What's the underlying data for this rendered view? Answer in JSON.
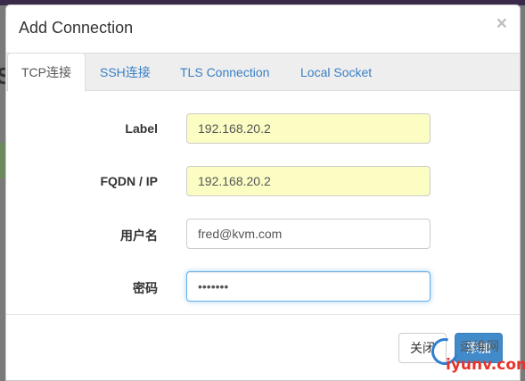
{
  "dialog": {
    "title": "Add Connection",
    "close_glyph": "×"
  },
  "tabs": [
    {
      "label": "TCP连接",
      "active": true
    },
    {
      "label": "SSH连接",
      "active": false
    },
    {
      "label": "TLS Connection",
      "active": false
    },
    {
      "label": "Local Socket",
      "active": false
    }
  ],
  "form": {
    "label": {
      "label": "Label",
      "value": "192.168.20.2"
    },
    "fqdn": {
      "label": "FQDN / IP",
      "value": "192.168.20.2"
    },
    "username": {
      "label": "用户名",
      "value": "fred@kvm.com"
    },
    "password": {
      "label": "密码",
      "value": "•••••••"
    }
  },
  "footer": {
    "close_label": "关闭",
    "add_label": "添加"
  },
  "watermark": {
    "text_top": "运维网",
    "text": "iyunv.com"
  },
  "colors": {
    "accent": "#428bca",
    "tab_link": "#3a7fc4",
    "autofill_bg": "#fbfdc3",
    "focus_border": "#66afe9"
  }
}
